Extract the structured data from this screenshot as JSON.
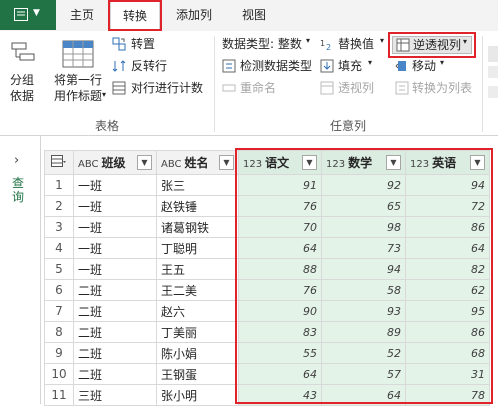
{
  "tabs": {
    "file": "▼",
    "home": "主页",
    "transform": "转换",
    "add_column": "添加列",
    "view": "视图"
  },
  "ribbon": {
    "group_by": "分组\n依据",
    "use_first_row": "将第一行\n用作标题",
    "transpose": "转置",
    "reverse_rows": "反转行",
    "count_rows": "对行进行计数",
    "group_table_label": "表格",
    "data_type": "数据类型: 整数",
    "detect_type": "检测数据类型",
    "rename": "重命名",
    "replace_values": "替换值",
    "fill": "填充",
    "pivot_column": "透视列",
    "unpivot": "逆透视列",
    "move": "移动",
    "convert_to_list": "转换为列表",
    "group_anycol_label": "任意列"
  },
  "nav": {
    "label": "查询"
  },
  "columns": [
    {
      "type": "ABC",
      "name": "班级"
    },
    {
      "type": "ABC",
      "name": "姓名"
    },
    {
      "type": "123",
      "name": "语文"
    },
    {
      "type": "123",
      "name": "数学"
    },
    {
      "type": "123",
      "name": "英语"
    }
  ],
  "rows": [
    {
      "no": "1",
      "class": "一班",
      "name": "张三",
      "chinese": "91",
      "math": "92",
      "english": "94"
    },
    {
      "no": "2",
      "class": "一班",
      "name": "赵铁锤",
      "chinese": "76",
      "math": "65",
      "english": "72"
    },
    {
      "no": "3",
      "class": "一班",
      "name": "诸葛钢铁",
      "chinese": "70",
      "math": "98",
      "english": "86"
    },
    {
      "no": "4",
      "class": "一班",
      "name": "丁聪明",
      "chinese": "64",
      "math": "73",
      "english": "64"
    },
    {
      "no": "5",
      "class": "一班",
      "name": "王五",
      "chinese": "88",
      "math": "94",
      "english": "82"
    },
    {
      "no": "6",
      "class": "二班",
      "name": "王二美",
      "chinese": "76",
      "math": "58",
      "english": "62"
    },
    {
      "no": "7",
      "class": "二班",
      "name": "赵六",
      "chinese": "90",
      "math": "93",
      "english": "95"
    },
    {
      "no": "8",
      "class": "二班",
      "name": "丁美丽",
      "chinese": "83",
      "math": "89",
      "english": "86"
    },
    {
      "no": "9",
      "class": "二班",
      "name": "陈小娟",
      "chinese": "55",
      "math": "52",
      "english": "68"
    },
    {
      "no": "10",
      "class": "二班",
      "name": "王钢蛋",
      "chinese": "64",
      "math": "57",
      "english": "31"
    },
    {
      "no": "11",
      "class": "三班",
      "name": "张小明",
      "chinese": "43",
      "math": "64",
      "english": "78"
    }
  ],
  "colors": {
    "accent": "#217346",
    "highlight": "#e0232a",
    "numeric_bg": "#e4f3e8"
  }
}
